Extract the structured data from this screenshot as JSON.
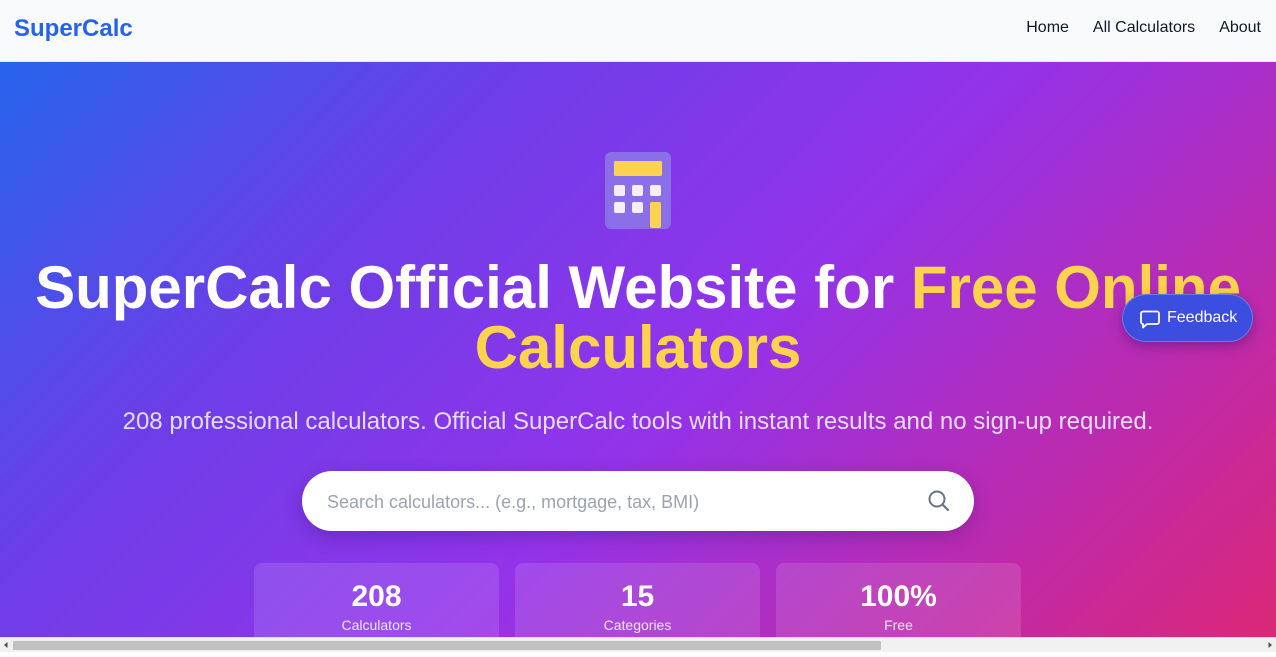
{
  "navbar": {
    "brand": "SuperCalc",
    "links": [
      "Home",
      "All Calculators",
      "About"
    ]
  },
  "hero": {
    "icon": "calculator-icon",
    "title_main": "SuperCalc Official Website for ",
    "title_accent": "Free Online Calculators",
    "subtitle": "208 professional calculators. Official SuperCalc tools with instant results and no sign-up required."
  },
  "search": {
    "placeholder": "Search calculators... (e.g., mortgage, tax, BMI)",
    "value": "",
    "icon": "search-icon"
  },
  "stats": [
    {
      "value": "208",
      "label": "Calculators"
    },
    {
      "value": "15",
      "label": "Categories"
    },
    {
      "value": "100%",
      "label": "Free"
    }
  ],
  "feedback": {
    "label": "Feedback",
    "icon": "chat-bubble-icon"
  },
  "colors": {
    "brand": "#2563eb",
    "accent": "#fcd34d",
    "gradient_start": "#2563eb",
    "gradient_mid": "#9333ea",
    "gradient_end": "#db2777",
    "feedback_bg": "#3b4ee0"
  }
}
